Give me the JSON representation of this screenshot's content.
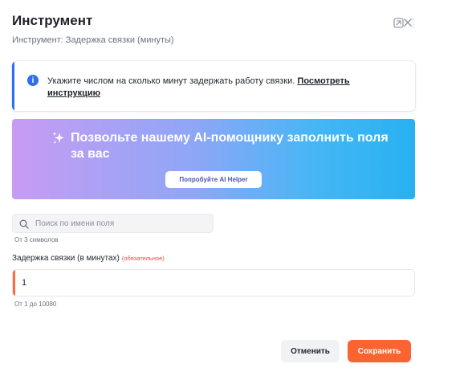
{
  "header": {
    "title": "Инструмент",
    "subtitle": "Инструмент: Задержка связки (минуты)"
  },
  "info": {
    "text": "Укажите числом на сколько минут задержать работу связки. ",
    "link": "Посмотреть инструкцию",
    "accent_color": "#2f6fed"
  },
  "ai_banner": {
    "heading": "Позвольте нашему AI-помощнику заполнить поля за вас",
    "button_label": "Попробуйте AI Helper"
  },
  "search": {
    "placeholder": "Поиск по имени поля",
    "value": "",
    "hint": "От 3 символов"
  },
  "field": {
    "label": "Задержка связки (в минутах)",
    "required_label": "(обязательное)",
    "value": "1",
    "hint": "От 1 до 10080",
    "accent_color": "#ff6b3d"
  },
  "footer": {
    "cancel_label": "Отменить",
    "save_label": "Сохранить",
    "save_color": "#fa6431"
  },
  "icons": {
    "collapse": "collapse-icon",
    "close": "close-icon",
    "info": "info-icon",
    "sparkle": "sparkle-icon",
    "search": "search-icon"
  }
}
